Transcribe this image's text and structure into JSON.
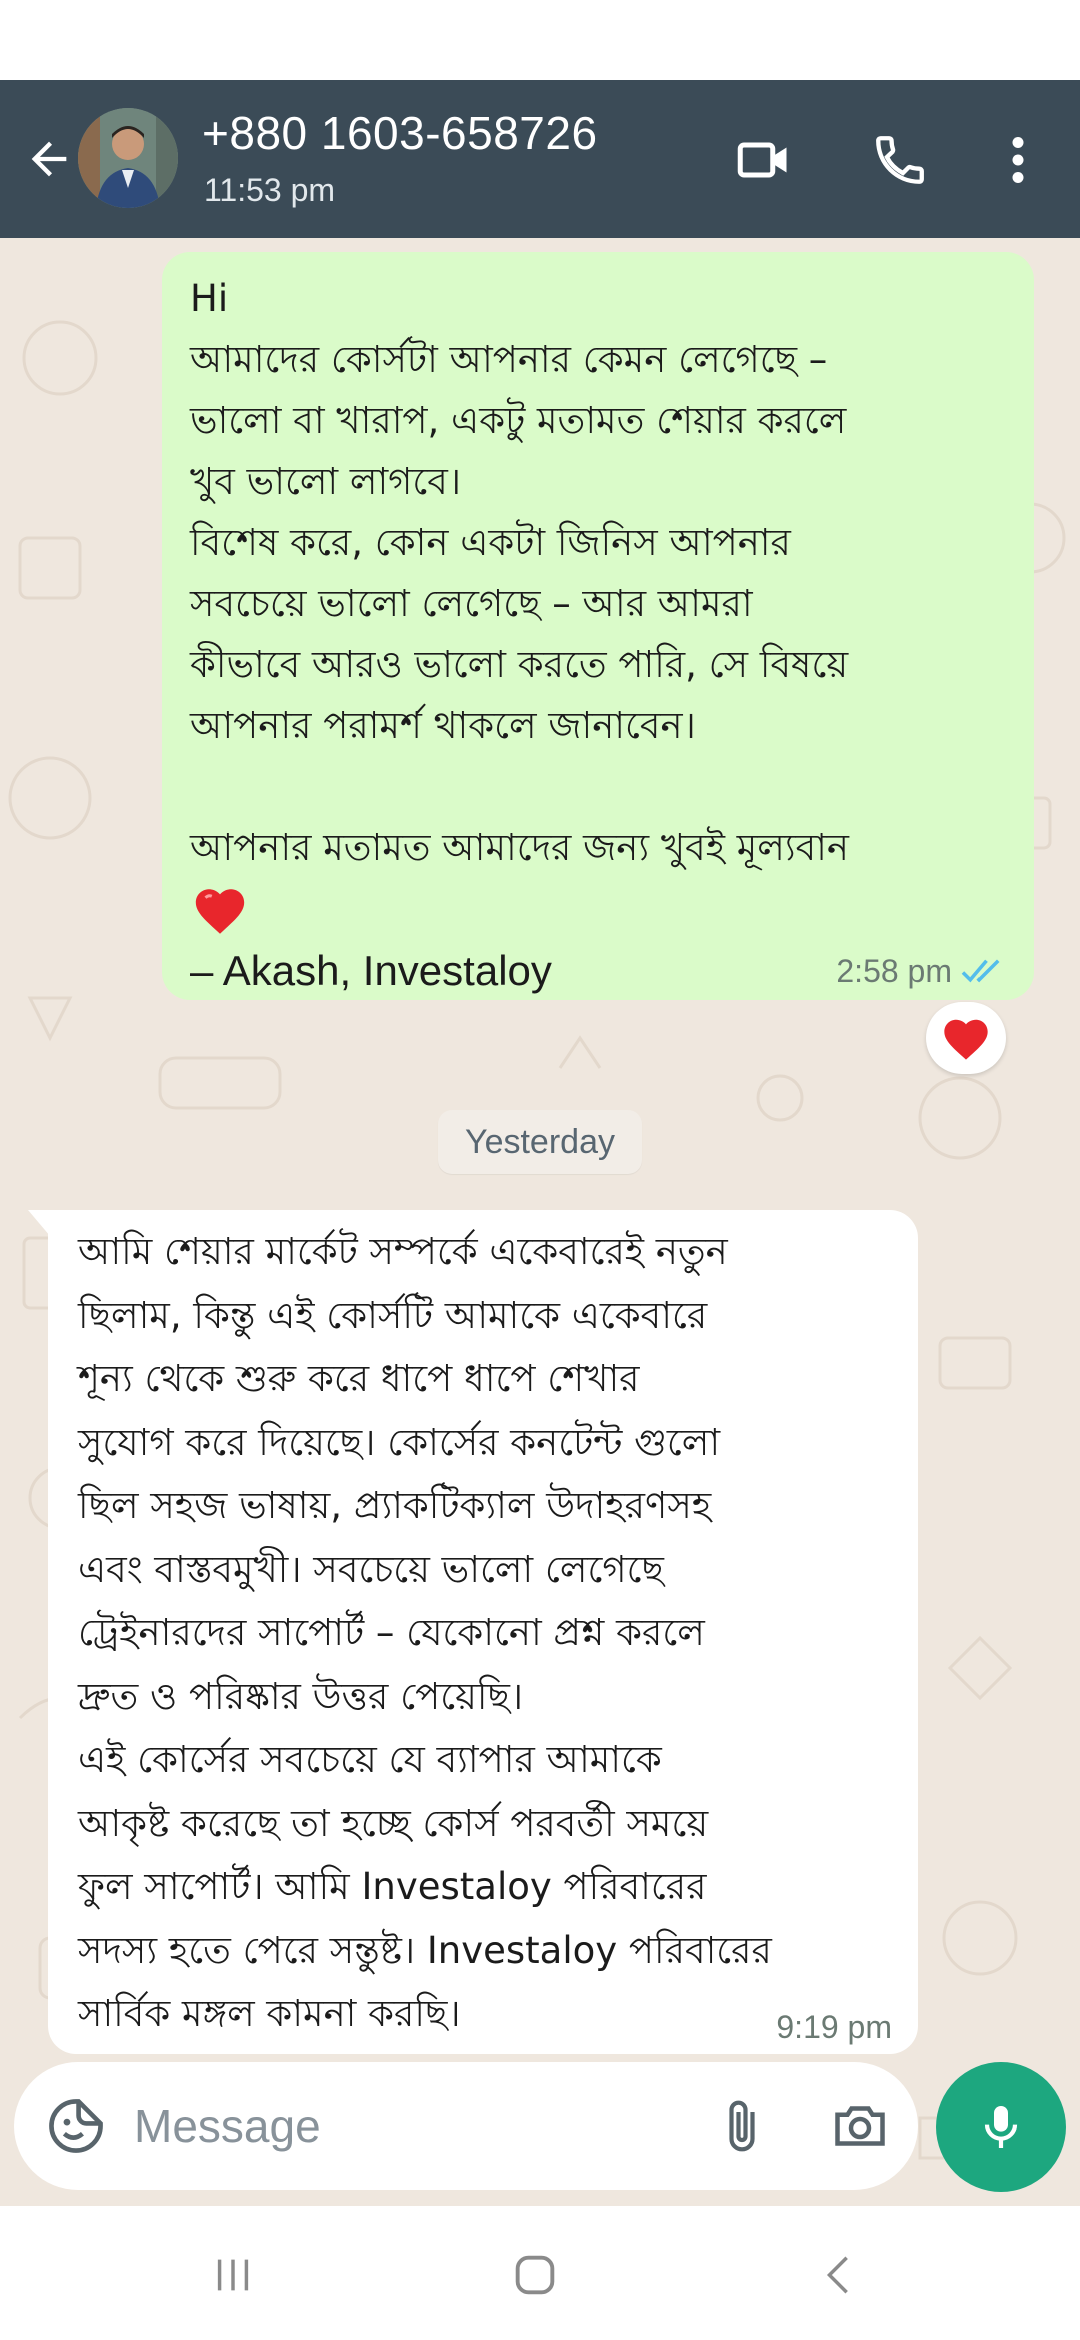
{
  "header": {
    "contact_name": "+880 1603-658726",
    "last_seen": "11:53 pm",
    "icons": [
      "back-arrow-icon",
      "video-call-icon",
      "voice-call-icon",
      "more-options-icon"
    ]
  },
  "messages": {
    "outgoing": {
      "text": "Hi\nআমাদের কোর্সটা আপনার কেমন লেগেছে –\nভালো বা খারাপ, একটু মতামত শেয়ার করলে\nখুব ভালো লাগবে।\nবিশেষ করে, কোন একটা জিনিস আপনার\nসবচেয়ে ভালো লেগেছে – আর আমরা\nকীভাবে আরও ভালো করতে পারি, সে বিষয়ে\nআপনার পরামর্শ থাকলে জানাবেন।\n\nআপনার মতামত আমাদের জন্য খুবই মূল্যবান",
      "signature": "– Akash, Investaloy",
      "time": "2:58 pm",
      "status": "read",
      "reaction": "heart"
    },
    "date_separator": "Yesterday",
    "incoming": {
      "text": "আমি শেয়ার মার্কেট সম্পর্কে একেবারেই নতুন\nছিলাম, কিন্তু এই কোর্সটি আমাকে একেবারে\nশূন্য থেকে শুরু করে ধাপে ধাপে শেখার\nসুযোগ করে দিয়েছে। কোর্সের কনটেন্ট গুলো\nছিল সহজ ভাষায়, প্র্যাকটিক্যাল উদাহরণসহ\nএবং বাস্তবমুখী। সবচেয়ে ভালো লেগেছে\nট্রেইনারদের সাপোর্ট – যেকোনো প্রশ্ন করলে\nদ্রুত ও পরিষ্কার উত্তর পেয়েছি।\nএই কোর্সের সবচেয়ে যে ব্যাপার আমাকে\nআকৃষ্ট করেছে তা হচ্ছে কোর্স পরবর্তী সময়ে\nফুল সাপোর্ট। আমি Investaloy পরিবারের\nসদস্য হতে পেরে সন্তুষ্ট। Investaloy পরিবারের\nসার্বিক মঙ্গল কামনা করছি।",
      "time": "9:19 pm"
    }
  },
  "composer": {
    "placeholder": "Message",
    "icons": [
      "emoji-icon",
      "attach-icon",
      "camera-icon",
      "mic-icon"
    ]
  },
  "colors": {
    "header_bg": "#3b4b57",
    "chat_bg": "#efe7de",
    "outgoing_bubble": "#dafbc9",
    "incoming_bubble": "#ffffff",
    "accent_green": "#1da77f",
    "read_tick": "#53bdeb",
    "heart": "#e8262c"
  }
}
